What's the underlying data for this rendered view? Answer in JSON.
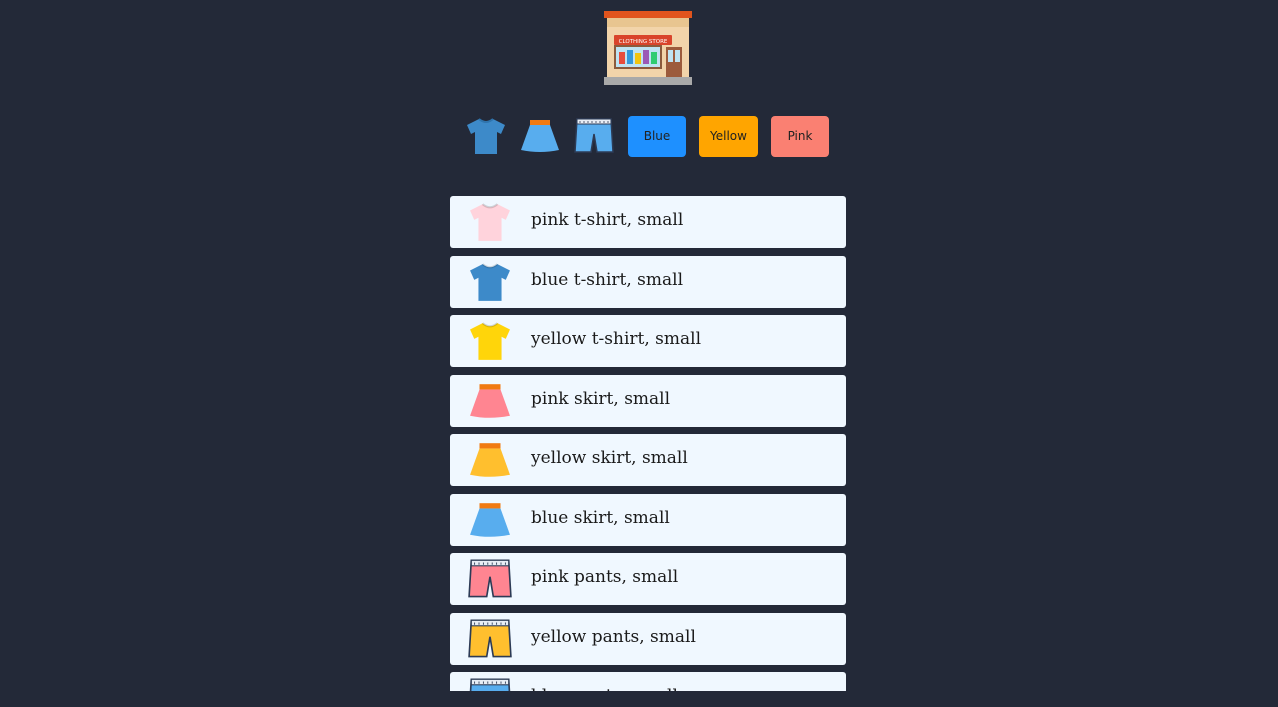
{
  "store": {
    "logo_icon": "clothing-store-icon",
    "sign_text": "CLOTHING STORE"
  },
  "filters": {
    "type_icons": [
      "tshirt-icon",
      "skirt-icon",
      "pants-icon"
    ],
    "colors": [
      {
        "label": "Blue",
        "color": "#1e90ff"
      },
      {
        "label": "Yellow",
        "color": "#ffa500"
      },
      {
        "label": "Pink",
        "color": "#fa8072"
      }
    ]
  },
  "items": [
    {
      "label": "pink t-shirt, small",
      "type": "tshirt",
      "color": "#ffd3dc"
    },
    {
      "label": "blue t-shirt, small",
      "type": "tshirt",
      "color": "#3d8ac9"
    },
    {
      "label": "yellow t-shirt, small",
      "type": "tshirt",
      "color": "#ffd50a"
    },
    {
      "label": "pink skirt, small",
      "type": "skirt",
      "color": "#ff8591"
    },
    {
      "label": "yellow skirt, small",
      "type": "skirt",
      "color": "#ffbf2e"
    },
    {
      "label": "blue skirt, small",
      "type": "skirt",
      "color": "#58adee"
    },
    {
      "label": "pink pants, small",
      "type": "pants",
      "color": "#ff8591"
    },
    {
      "label": "yellow pants, small",
      "type": "pants",
      "color": "#ffbf2e"
    },
    {
      "label": "blue pants, small",
      "type": "pants",
      "color": "#58adee"
    }
  ]
}
